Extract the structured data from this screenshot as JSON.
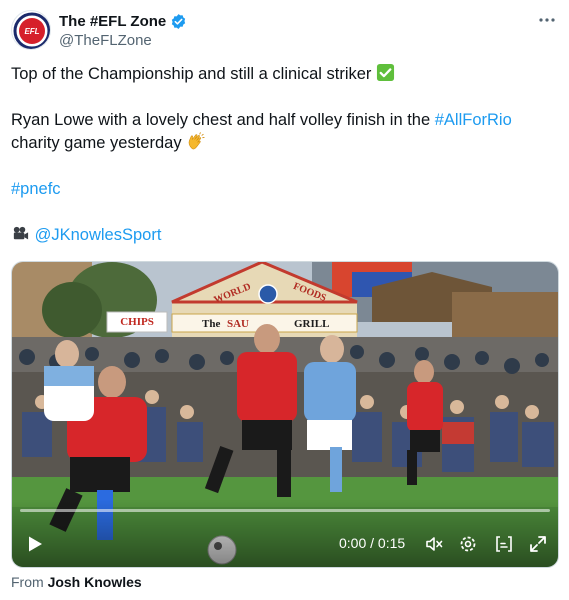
{
  "account": {
    "display_name": "The #EFL Zone",
    "handle": "@TheFLZone",
    "avatar_text": "EFL ZONE",
    "verified": true
  },
  "tweet": {
    "line1": "Top of the Championship and still a clinical striker",
    "line1_emoji": "white-check-mark-emoji",
    "line2_prefix": "Ryan Lowe with a lovely chest and half volley finish in the ",
    "line2_hashtag": "#AllForRio",
    "line3": "charity game yesterday",
    "line3_emoji": "clapping-hands-emoji",
    "hashtag": "#pnefc",
    "credit_mention": "@JKnowlesSport",
    "credit_icon": "movie-camera-emoji"
  },
  "video": {
    "scene_signs": {
      "chips": "CHIPS",
      "world": "WORLD",
      "foods": "FOODS",
      "the": "The",
      "sau": "SAU",
      "grill": "GRILL"
    },
    "current_time": "0:00",
    "separator": "/",
    "duration": "0:15",
    "progress": 0,
    "icons": [
      "play-icon",
      "mute-icon",
      "settings-icon",
      "subtitles-icon",
      "fullscreen-icon"
    ]
  },
  "source": {
    "prefix": "From",
    "name": "Josh Knowles"
  },
  "colors": {
    "link": "#1d9bf0",
    "verified": "#1d9bf0",
    "secondary_text": "#536471"
  }
}
